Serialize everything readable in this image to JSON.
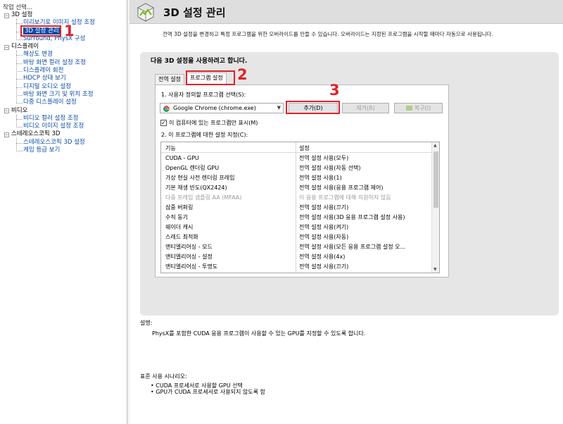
{
  "sidebar": {
    "title": "작업 선택...",
    "groups": [
      {
        "label": "3D 설정",
        "items": [
          "미리보기로 이미지 설정 조정",
          "3D 설정 관리",
          "Surround, PhysX 구성"
        ]
      },
      {
        "label": "디스플레이",
        "items": [
          "해상도 변경",
          "바탕 화면 컬러 설정 조정",
          "디스플레이 회전",
          "HDCP 상태 보기",
          "디지털 오디오 설정",
          "바탕 화면 크기 및 위치 조정",
          "다중 디스플레이 설정"
        ]
      },
      {
        "label": "비디오",
        "items": [
          "비디오 컬러 설정 조정",
          "비디오 이미지 설정 조정"
        ]
      },
      {
        "label": "스테레오스코픽 3D",
        "items": [
          "스테레오스코픽 3D 설정",
          "게임 등급 보기"
        ]
      }
    ],
    "expander_symbol": "−"
  },
  "header": {
    "title": "3D 설정 관리",
    "intro": "전역 3D 설정을 변경하고 특정 프로그램을 위한 오버라이드를 만들 수 있습니다. 오버라이드는 지정된 프로그램을 시작할 때마다 자동으로 사용됩니다."
  },
  "main": {
    "section_title": "다음 3D 설정을 사용하려고 합니다.",
    "tabs": {
      "global": "전역 설정",
      "program": "프로그램 설정"
    },
    "step1": "1. 사용자 정의할 프로그램 선택(S):",
    "program_value": "Google Chrome (chrome.exe)",
    "buttons": {
      "add": "추가(D)",
      "remove": "제거(R)",
      "restore": "복구(I)"
    },
    "checkbox_label": "이 컴퓨터에 있는 프로그램만 표시(M)",
    "checkbox_checked": "✓",
    "step2": "2. 이 프로그램에 대한 설정 지정(C):",
    "columns": {
      "feature": "기능",
      "setting": "설정"
    },
    "rows": [
      {
        "feature": "CUDA - GPU",
        "setting": "전역 설정 사용(모두)"
      },
      {
        "feature": "OpenGL 렌더링 GPU",
        "setting": "전역 설정 사용(자동 선택)"
      },
      {
        "feature": "가상 현실 사전 렌더링 프레임",
        "setting": "전역 설정 사용(1)"
      },
      {
        "feature": "기본 재생 빈도(QX2424)",
        "setting": "전역 설정 사용(응용 프로그램 제어)"
      },
      {
        "feature": "다중 프레임 샘플링 AA (MFAA)",
        "setting": "이 응용 프로그램에 대해 지원하지 않음"
      },
      {
        "feature": "삼중 버퍼링",
        "setting": "전역 설정 사용(끄기)"
      },
      {
        "feature": "수직 동기",
        "setting": "전역 설정 사용(3D 응용 프로그램 설정 사용)"
      },
      {
        "feature": "쉐이더 캐시",
        "setting": "전역 설정 사용(켜기)"
      },
      {
        "feature": "스레드 최적화",
        "setting": "전역 설정 사용(자동)"
      },
      {
        "feature": "앤티엘리어싱 - 모드",
        "setting": "전역 설정 사용(모든 응용 프로그램 설정 오..."
      },
      {
        "feature": "앤티엘리어싱 - 설정",
        "setting": "전역 설정 사용(4x)"
      },
      {
        "feature": "앤티엘리어싱 - 투명도",
        "setting": "전역 설정 사용(끄기)"
      }
    ]
  },
  "description": {
    "label": "설명:",
    "text": "PhysX를 포함한 CUDA 응용 프로그램이 사용할 수 있는 GPU를 지정할 수 있도록 합니다."
  },
  "usage": {
    "label": "표준 사용 시나리오:",
    "items": [
      "CUDA 프로세서로 사용할 GPU 선택",
      "GPU가 CUDA 프로세서로 사용되지 않도록 함"
    ]
  },
  "annotations": {
    "n1": "1",
    "n2": "2",
    "n3": "3"
  },
  "colors": {
    "annotation": "#e0212b",
    "link": "#0a4aa6",
    "selection": "#0a4aa6"
  }
}
